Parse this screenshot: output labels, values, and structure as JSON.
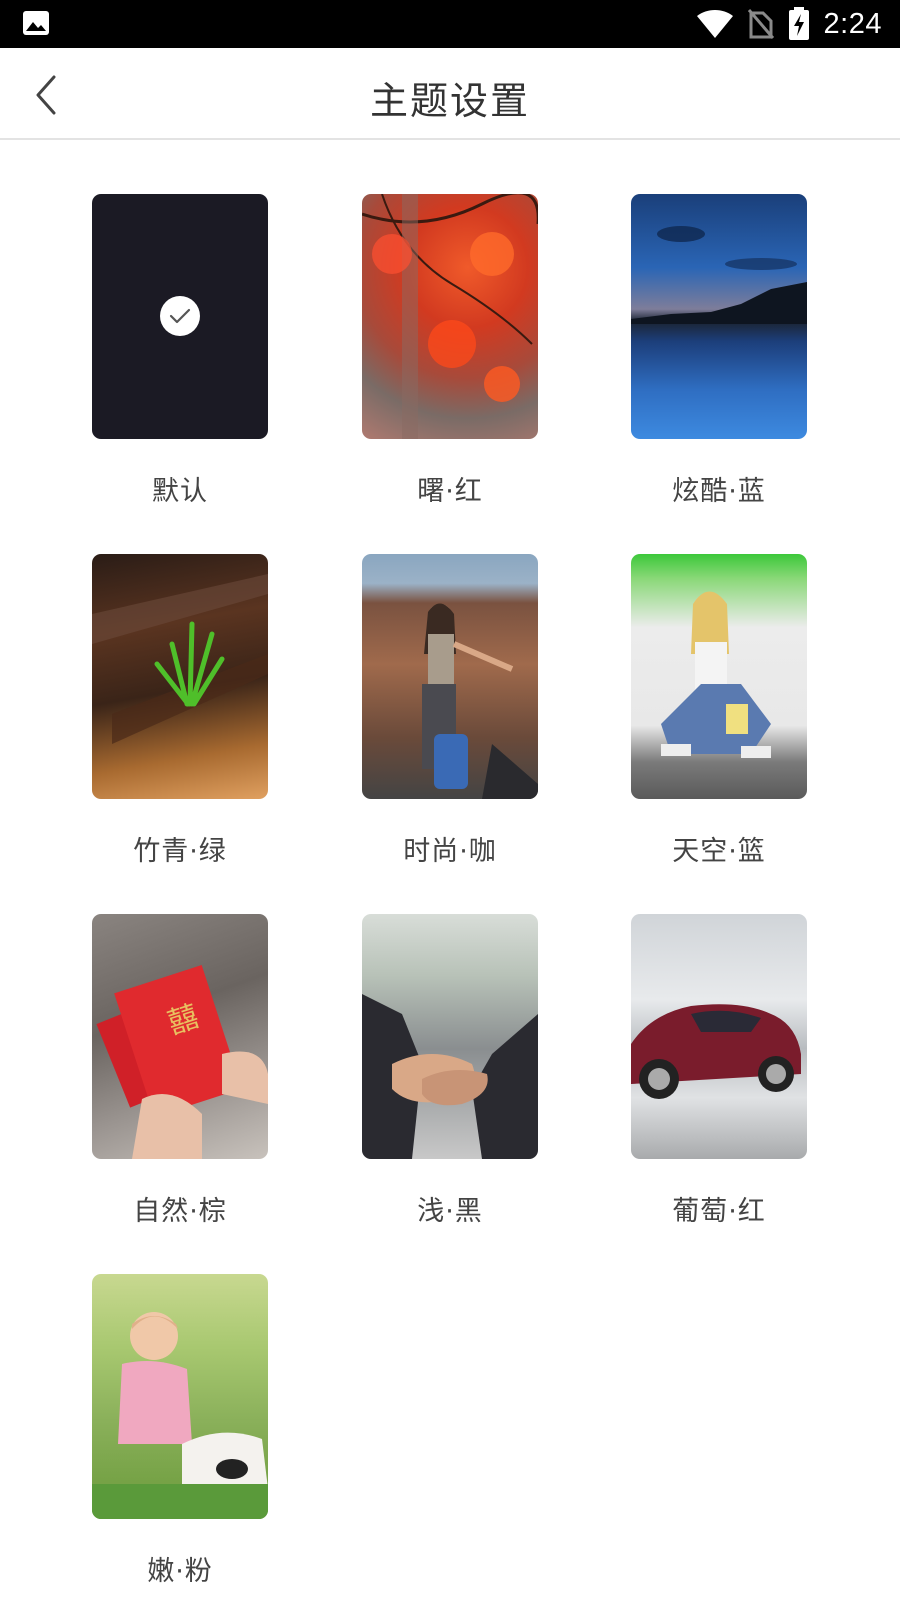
{
  "status_bar": {
    "time": "2:24",
    "icons": [
      "image-icon",
      "wifi-icon",
      "no-sim-icon",
      "battery-charging-icon"
    ]
  },
  "app_bar": {
    "title": "主题设置",
    "back_icon": "chevron-left-icon"
  },
  "themes": [
    {
      "label": "默认",
      "selected": true,
      "color": "#1b1a24"
    },
    {
      "label": "曙·红",
      "selected": false,
      "color": "#c7452c"
    },
    {
      "label": "炫酷·蓝",
      "selected": false,
      "color": "#1f5da6"
    },
    {
      "label": "竹青·绿",
      "selected": false,
      "color": "#6b4424"
    },
    {
      "label": "时尚·咖",
      "selected": false,
      "color": "#8b6a52"
    },
    {
      "label": "天空·篮",
      "selected": false,
      "color": "#6c88b5"
    },
    {
      "label": "自然·棕",
      "selected": false,
      "color": "#cf2430"
    },
    {
      "label": "浅·黑",
      "selected": false,
      "color": "#3b3a3e"
    },
    {
      "label": "葡萄·红",
      "selected": false,
      "color": "#8a1f2e"
    },
    {
      "label": "嫩·粉",
      "selected": false,
      "color": "#8fb35a"
    }
  ]
}
